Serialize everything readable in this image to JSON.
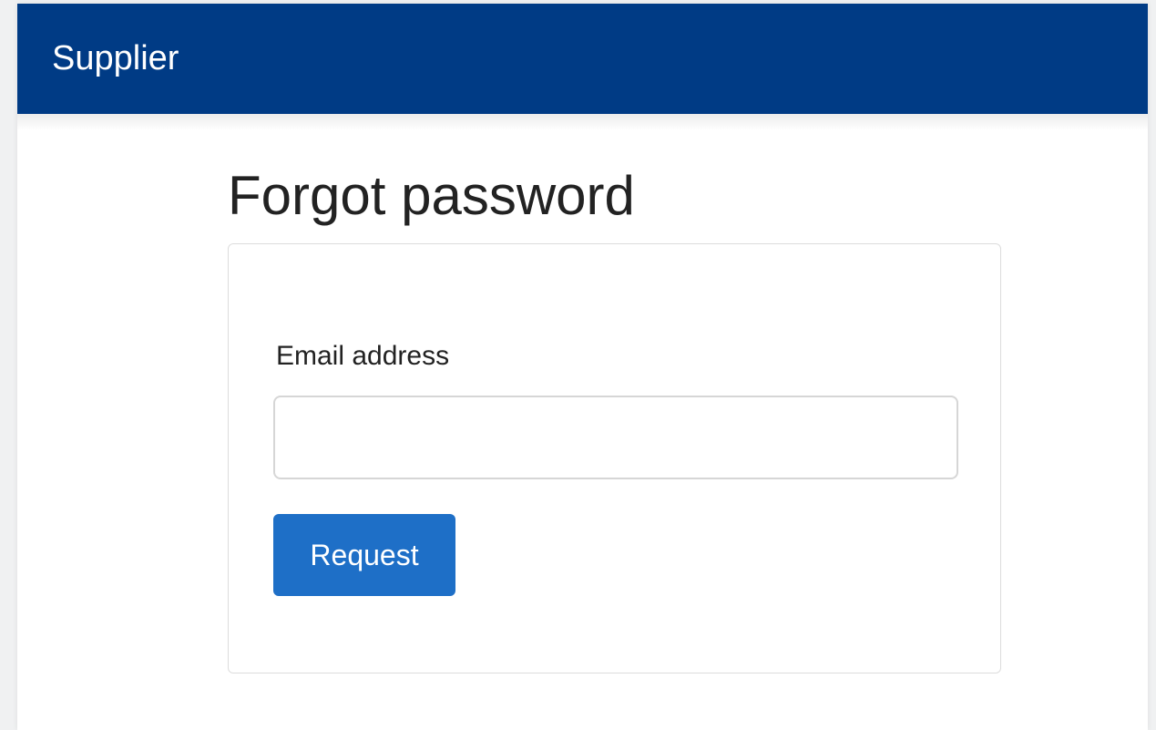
{
  "navbar": {
    "brand": "Supplier"
  },
  "main": {
    "title": "Forgot password"
  },
  "form": {
    "email_label": "Email address",
    "email_value": "",
    "email_placeholder": "",
    "request_label": "Request"
  },
  "colors": {
    "navbar": "#003b85",
    "button": "#1e6fc7"
  }
}
